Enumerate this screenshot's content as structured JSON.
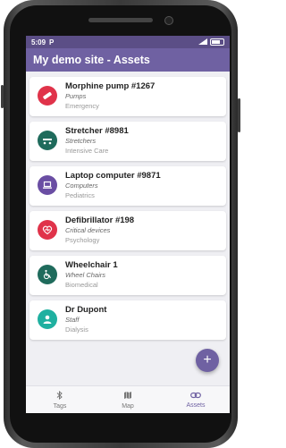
{
  "status": {
    "time": "5:09",
    "carrier_icon": "P",
    "signal_icon": "signal-icon",
    "battery_icon": "battery-icon"
  },
  "appbar": {
    "title": "My demo site - Assets"
  },
  "assets": [
    {
      "name": "Morphine pump #1267",
      "category": "Pumps",
      "location": "Emergency",
      "icon": "pump-icon",
      "color": "#e0334a"
    },
    {
      "name": "Stretcher #8981",
      "category": "Stretchers",
      "location": "Intensive Care",
      "icon": "stretcher-icon",
      "color": "#1f6b5c"
    },
    {
      "name": "Laptop computer #9871",
      "category": "Computers",
      "location": "Pediatrics",
      "icon": "laptop-icon",
      "color": "#6a4ea3"
    },
    {
      "name": "Defibrillator #198",
      "category": "Critical devices",
      "location": "Psychology",
      "icon": "heart-icon",
      "color": "#e0334a"
    },
    {
      "name": "Wheelchair 1",
      "category": "Wheel Chairs",
      "location": "Biomedical",
      "icon": "wheelchair-icon",
      "color": "#1f6b5c"
    },
    {
      "name": "Dr Dupont",
      "category": "Staff",
      "location": "Dialysis",
      "icon": "person-icon",
      "color": "#1fb0a0"
    }
  ],
  "fab": {
    "label": "+"
  },
  "nav": [
    {
      "label": "Tags",
      "icon": "bluetooth-icon",
      "active": false
    },
    {
      "label": "Map",
      "icon": "map-icon",
      "active": false
    },
    {
      "label": "Assets",
      "icon": "link-icon",
      "active": true
    }
  ],
  "colors": {
    "primary": "#6f61a2",
    "statusbar": "#5b4e86"
  }
}
